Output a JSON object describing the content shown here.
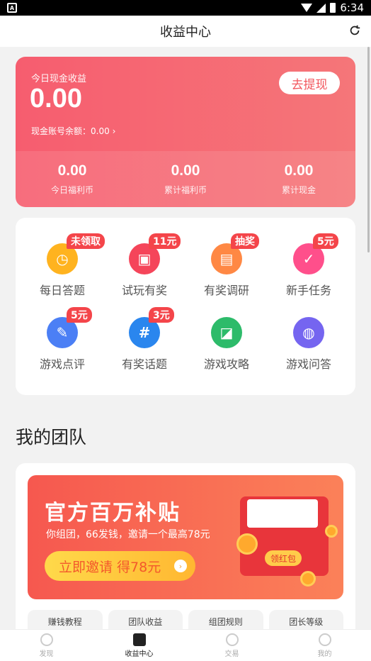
{
  "status_bar": {
    "time": "6:34"
  },
  "header": {
    "title": "收益中心"
  },
  "earnings": {
    "today_label": "今日现金收益",
    "today_value": "0.00",
    "balance_label": "现金账号余额：0.00",
    "withdraw_label": "去提现",
    "stats": [
      {
        "value": "0.00",
        "label": "今日福利币"
      },
      {
        "value": "0.00",
        "label": "累计福利币"
      },
      {
        "value": "0.00",
        "label": "累计现金"
      }
    ]
  },
  "tasks": [
    {
      "label": "每日答题",
      "badge": "未领取",
      "icon": "clock-icon",
      "color": "#ffb31f"
    },
    {
      "label": "试玩有奖",
      "badge": "11元",
      "icon": "gamepad-icon",
      "color": "#f5455a"
    },
    {
      "label": "有奖调研",
      "badge": "抽奖",
      "icon": "survey-icon",
      "color": "#ff8844"
    },
    {
      "label": "新手任务",
      "badge": "5元",
      "icon": "clipboard-icon",
      "color": "#ff4f8b"
    },
    {
      "label": "游戏点评",
      "badge": "5元",
      "icon": "comment-icon",
      "color": "#4b7ff5"
    },
    {
      "label": "有奖话题",
      "badge": "3元",
      "icon": "hashtag-icon",
      "color": "#2a86ee"
    },
    {
      "label": "游戏攻略",
      "badge": "",
      "icon": "guide-icon",
      "color": "#2dbb6a"
    },
    {
      "label": "游戏问答",
      "badge": "",
      "icon": "qa-icon",
      "color": "#7565f0"
    }
  ],
  "team": {
    "section_title": "我的团队",
    "banner_title": "官方百万补贴",
    "banner_sub": "你组团，66发钱，邀请一个最高78元",
    "invite_label": "立即邀请 得78元",
    "envelope_label": "领红包",
    "tabs": [
      "赚钱教程",
      "团队收益",
      "组团规则",
      "团长等级"
    ]
  },
  "bottom_nav": [
    {
      "label": "发现",
      "icon": "compass-icon",
      "active": false
    },
    {
      "label": "收益中心",
      "icon": "wallet-icon",
      "active": true
    },
    {
      "label": "交易",
      "icon": "exchange-icon",
      "active": false
    },
    {
      "label": "我的",
      "icon": "person-icon",
      "active": false
    }
  ]
}
